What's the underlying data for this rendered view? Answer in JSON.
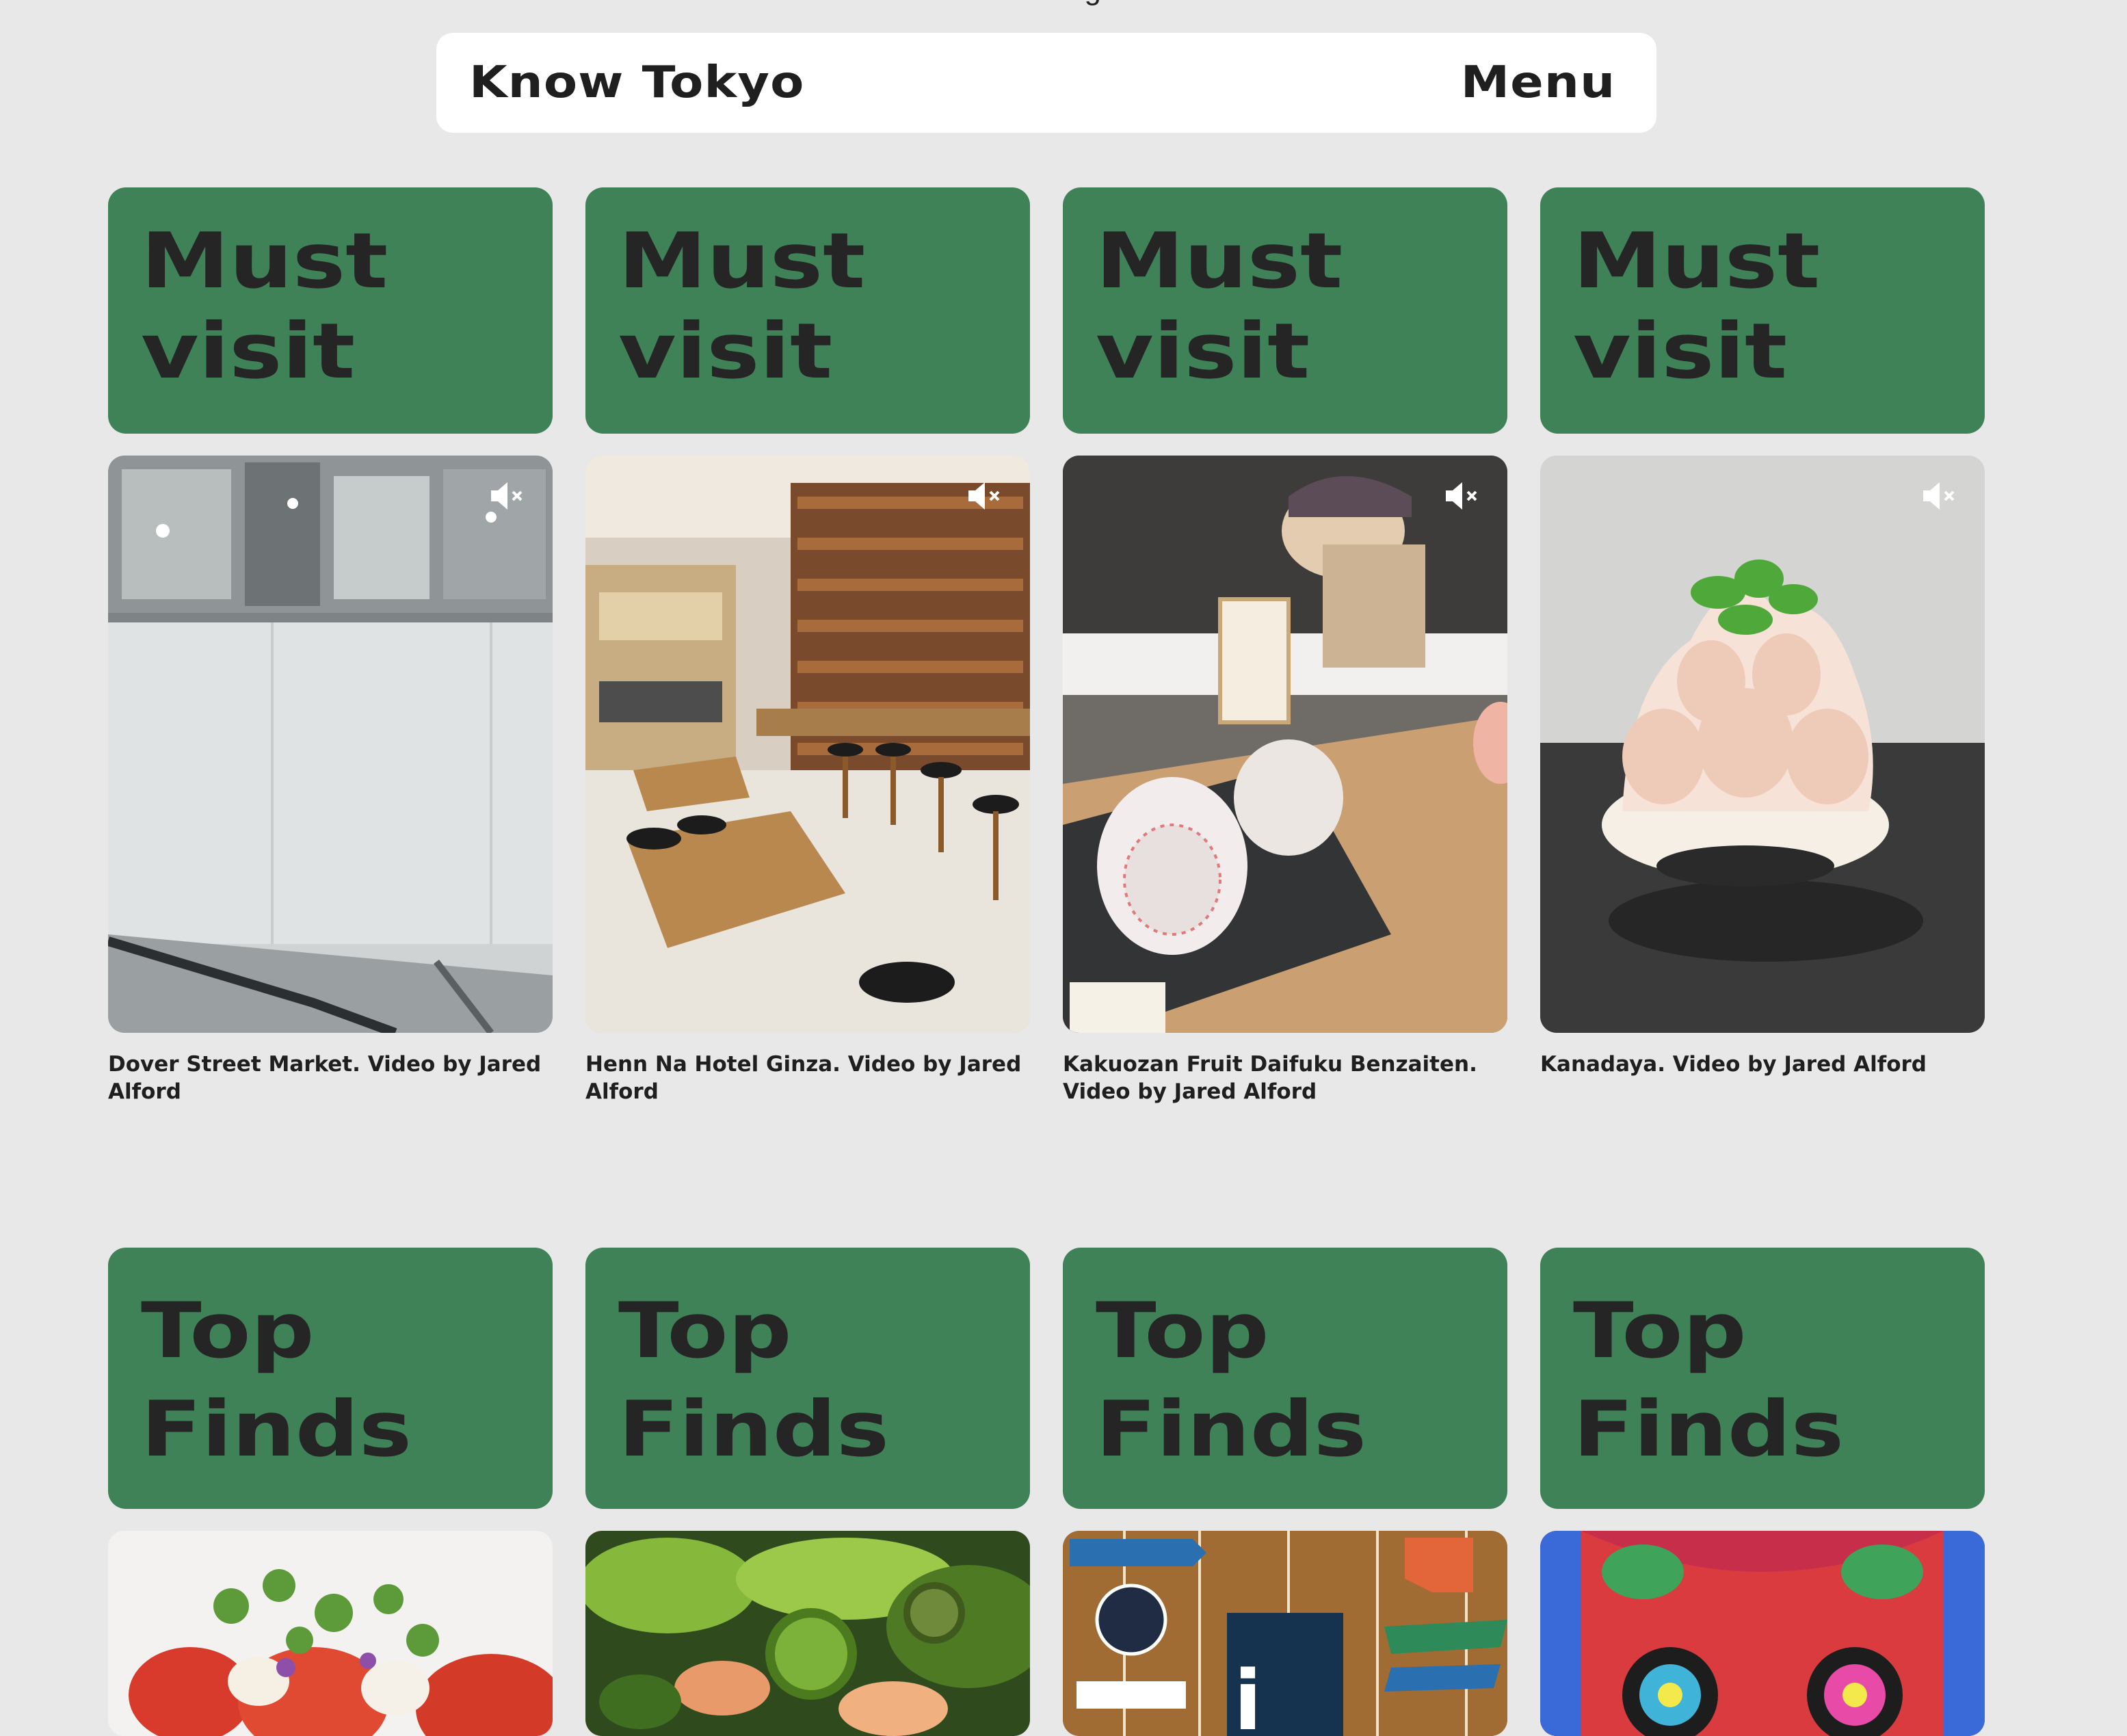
{
  "page": {
    "top_cut_text": "hotels in the neighbourhood."
  },
  "navbar": {
    "brand": "Know Tokyo",
    "menu_label": "Menu"
  },
  "must_visit": {
    "heading_line1": "Must",
    "heading_line2": "visit",
    "items": [
      {
        "caption": "Dover Street Market. Video by Jared Alford",
        "media_icon": "video-thumbnail"
      },
      {
        "caption": "Henn Na Hotel Ginza. Video by Jared Alford",
        "media_icon": "video-thumbnail"
      },
      {
        "caption": "Kakuozan Fruit Daifuku Benzaiten. Video by Jared Alford",
        "media_icon": "video-thumbnail"
      },
      {
        "caption": "Kanadaya. Video by Jared Alford",
        "media_icon": "video-thumbnail"
      }
    ]
  },
  "top_finds": {
    "heading_line1": "Top",
    "heading_line2": "Finds",
    "items": [
      {
        "media_icon": "salad-thumbnail"
      },
      {
        "media_icon": "greens-thumbnail"
      },
      {
        "media_icon": "store-sign-thumbnail"
      },
      {
        "media_icon": "illustration-thumbnail"
      }
    ]
  },
  "colors": {
    "background": "#e8e8e8",
    "card_green": "#3f8258",
    "navbar": "#ffffff"
  },
  "icons": {
    "mute": "speaker-muted-icon"
  }
}
